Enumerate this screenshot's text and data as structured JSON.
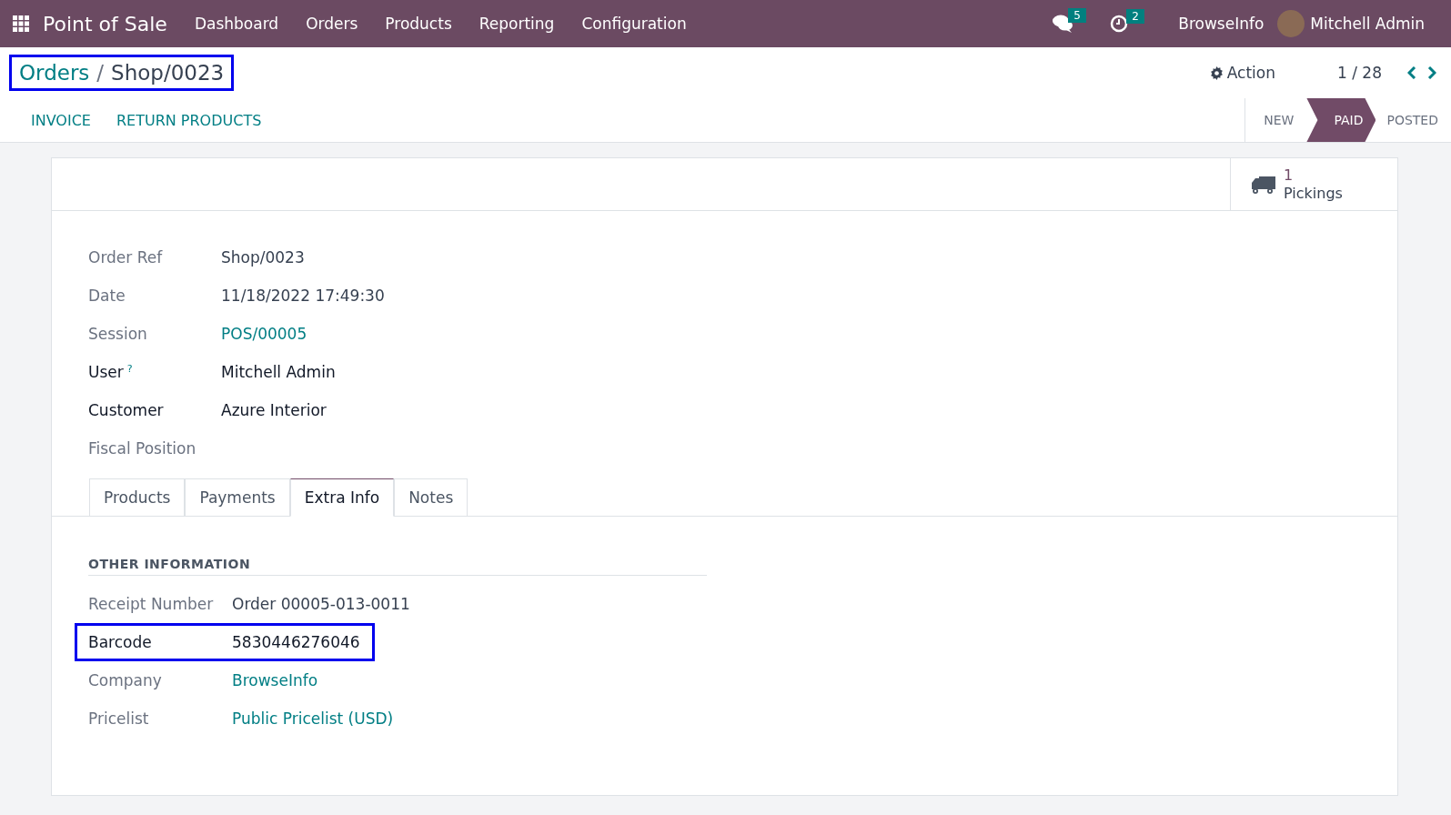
{
  "navbar": {
    "app_name": "Point of Sale",
    "menu": [
      "Dashboard",
      "Orders",
      "Products",
      "Reporting",
      "Configuration"
    ],
    "messages_count": "5",
    "activities_count": "2",
    "company": "BrowseInfo",
    "user": "Mitchell Admin"
  },
  "breadcrumb": {
    "parent": "Orders",
    "separator": "/",
    "current": "Shop/0023",
    "highlighted": true
  },
  "action_menu": "Action",
  "pager": "1 / 28",
  "buttons": [
    "INVOICE",
    "RETURN PRODUCTS"
  ],
  "statusbar": [
    {
      "label": "NEW",
      "selected": false
    },
    {
      "label": "PAID",
      "selected": true
    },
    {
      "label": "POSTED",
      "selected": false
    }
  ],
  "smart_button": {
    "count": "1",
    "label": "Pickings"
  },
  "fields": [
    {
      "label": "Order Ref",
      "value": "Shop/0023",
      "kind": "text",
      "readonly": true
    },
    {
      "label": "Date",
      "value": "11/18/2022 17:49:30",
      "kind": "text",
      "readonly": true
    },
    {
      "label": "Session",
      "value": "POS/00005",
      "kind": "link",
      "readonly": true
    },
    {
      "label": "User",
      "help": "?",
      "value": "Mitchell Admin",
      "kind": "text",
      "readonly": false
    },
    {
      "label": "Customer",
      "value": "Azure Interior",
      "kind": "text",
      "readonly": false
    },
    {
      "label": "Fiscal Position",
      "kind": "empty",
      "readonly": true
    }
  ],
  "tabs": [
    {
      "label": "Products",
      "selected": false
    },
    {
      "label": "Payments",
      "selected": false
    },
    {
      "label": "Extra Info",
      "selected": true
    },
    {
      "label": "Notes",
      "selected": false
    }
  ],
  "extra_info": {
    "heading": "OTHER INFORMATION",
    "fields": [
      {
        "label": "Receipt Number",
        "value": "Order 00005-013-0011",
        "kind": "text",
        "readonly": true,
        "highlighted": false
      },
      {
        "label": "Barcode",
        "value": "5830446276046",
        "kind": "text",
        "readonly": false,
        "highlighted": true
      },
      {
        "label": "Company",
        "value": "BrowseInfo",
        "kind": "link",
        "readonly": true,
        "highlighted": false
      },
      {
        "label": "Pricelist",
        "value": "Public Pricelist (USD)",
        "kind": "link",
        "readonly": true,
        "highlighted": false
      }
    ]
  }
}
